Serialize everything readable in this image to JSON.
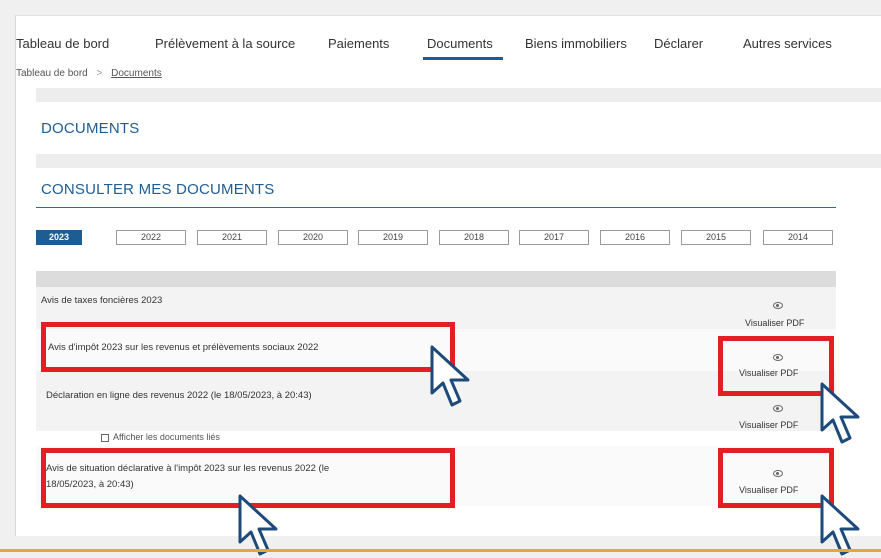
{
  "nav": {
    "items": [
      "Tableau de bord",
      "Prélèvement à la source",
      "Paiements",
      "Documents",
      "Biens immobiliers",
      "Déclarer",
      "Autres services"
    ],
    "active": "Documents"
  },
  "breadcrumb": {
    "home": "Tableau de bord",
    "separator": ">",
    "current": "Documents"
  },
  "page_title": "DOCUMENTS",
  "section_title": "CONSULTER MES DOCUMENTS",
  "years": [
    "2023",
    "2022",
    "2021",
    "2020",
    "2019",
    "2018",
    "2017",
    "2016",
    "2015",
    "2014"
  ],
  "active_year": "2023",
  "documents": [
    {
      "label": "Avis de taxes foncières 2023",
      "action": "Visualiser PDF",
      "highlighted": false
    },
    {
      "label": "Avis d'impôt 2023 sur les revenus et prélèvements sociaux 2022",
      "action": "Visualiser PDF",
      "highlighted": true
    },
    {
      "label": "Déclaration en ligne des revenus 2022 (le 18/05/2023, à 20:43)",
      "action": "Visualiser PDF",
      "highlighted": false
    },
    {
      "label_line1": "Avis de situation déclarative à l'impôt 2023 sur les revenus 2022 (le",
      "label_line2": "18/05/2023, à 20:43)",
      "action": "Visualiser PDF",
      "highlighted": true
    }
  ],
  "linked_docs": "Afficher les documents liés",
  "colors": {
    "accent": "#1e5d93",
    "highlight": "#e31e24",
    "cursor": "#1e4a7a",
    "footer_line": "#f0a13a"
  },
  "icons": [
    "eye-icon",
    "cursor-arrow-icon",
    "checkbox-icon"
  ]
}
